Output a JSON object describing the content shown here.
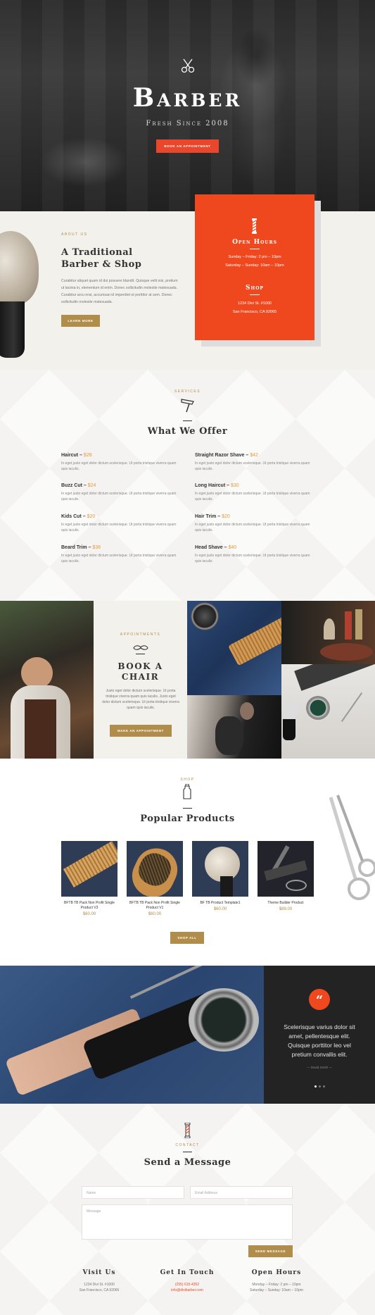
{
  "hero": {
    "title": "Barber",
    "subtitle": "Fresh Since 2008",
    "cta": "Book an Appointment"
  },
  "about": {
    "eyebrow": "About Us",
    "heading_line1": "A Traditional",
    "heading_line2": "Barber & Shop",
    "body": "Curabitur aliquet quam id dui posuere blandit. Quisque velit nisi, pretium ut lacinia in, elementum id enim. Donec sollicitudin molestie malesuada. Curabitur arcu erat, accumsan id imperdiet et porttitor at sem. Donec sollicitudin molestie malesuada.",
    "button": "Learn More"
  },
  "hours_card": {
    "open_title": "Open Hours",
    "weekdays": "Sunday – Friday: 2 pm – 10pm",
    "weekend": "Saturday – Sunday: 10am – 10pm",
    "shop_title": "Shop",
    "address1": "1234 Divi St. #1000",
    "address2": "San Francisco, CA 92065"
  },
  "services": {
    "eyebrow": "Services",
    "heading": "What We Offer",
    "desc": "In eget justo eget dolor dictum scelerisque. Ut porta tristique viverra quam quis iaculis.",
    "items": [
      {
        "name": "Haircut –",
        "price": "$28"
      },
      {
        "name": "Straight Razor Shave –",
        "price": "$42"
      },
      {
        "name": "Buzz Cut –",
        "price": "$24"
      },
      {
        "name": "Long Haircut –",
        "price": "$30"
      },
      {
        "name": "Kids Cut –",
        "price": "$20"
      },
      {
        "name": "Hair Trim –",
        "price": "$20"
      },
      {
        "name": "Beard Trim –",
        "price": "$38"
      },
      {
        "name": "Head Shave –",
        "price": "$40"
      }
    ]
  },
  "appointments": {
    "eyebrow": "Appointments",
    "heading_line1": "Book A",
    "heading_line2": "Chair",
    "body": "Justo eget dolor dictum scelerisque. Ut porta tristique viverra quam quis iaculis. Justo eget dolor dictum scelerisque. Ut porta tristique viverra quam quis iaculis.",
    "button": "Make an Appointment"
  },
  "shop": {
    "eyebrow": "Shop",
    "heading": "Popular Products",
    "products": [
      {
        "name": "BFTB TB Pack Non Profit Single Product V3",
        "price": "$60.00"
      },
      {
        "name": "BFTB TB Pack Non Profit Single Product V1",
        "price": "$60.00"
      },
      {
        "name": "BF TB Product Template1",
        "price": "$60.00"
      },
      {
        "name": "Theme Builder Product",
        "price": "$89.00"
      }
    ],
    "button": "Shop All"
  },
  "testimonial": {
    "quote": "Scelerisque varius dolor sit amet, pellentesque elit. Quisque porttitor leo vel pretium convallis elit.",
    "author": "— David Smith —"
  },
  "contact": {
    "eyebrow": "Contact",
    "heading": "Send a Message",
    "name_placeholder": "Name",
    "email_placeholder": "Email Address",
    "message_placeholder": "Message",
    "button": "Send Message"
  },
  "footer": {
    "visit": {
      "title": "Visit Us",
      "line1": "1234 Divi St. #1000",
      "line2": "San Francisco, CA 92065"
    },
    "touch": {
      "title": "Get In Touch",
      "phone": "(255) 615-4352",
      "email": "info@divibarber.com"
    },
    "hours": {
      "title": "Open Hours",
      "line1": "Monday – Friday: 2 pm – 10pm",
      "line2": "Saturday – Sunday: 10am – 10pm"
    }
  },
  "colors": {
    "accent": "#f0481e",
    "gold": "#b08d4a",
    "dark": "#222222"
  }
}
